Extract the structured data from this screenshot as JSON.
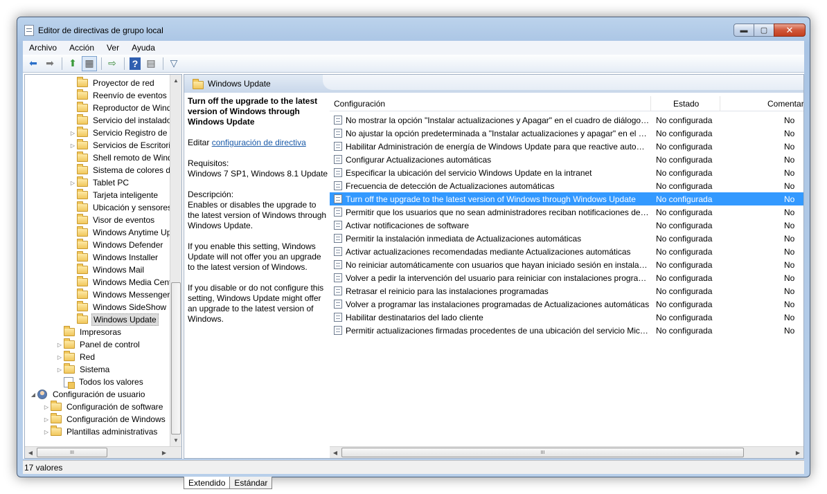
{
  "window": {
    "title": "Editor de directivas de grupo local",
    "buttons": {
      "minimize": "▬",
      "maximize": "▢",
      "close": "✕"
    }
  },
  "menu": [
    "Archivo",
    "Acción",
    "Ver",
    "Ayuda"
  ],
  "toolbar": {
    "icons": [
      "back-arrow-icon",
      "forward-arrow-icon",
      "up-folder-icon",
      "show-hide-tree-icon",
      "export-list-icon",
      "help-icon",
      "properties-icon",
      "filter-icon"
    ],
    "glyphs": [
      "⬅",
      "➡",
      "⬆",
      "▦",
      "⇨",
      "?",
      "▤",
      "▽"
    ]
  },
  "tree": {
    "items": [
      {
        "label": "Proyector de red",
        "indent": 4,
        "expander": ""
      },
      {
        "label": "Reenvío de eventos",
        "indent": 4,
        "expander": ""
      },
      {
        "label": "Reproductor de Windows Media",
        "indent": 4,
        "expander": ""
      },
      {
        "label": "Servicio del instalador de Windows",
        "indent": 4,
        "expander": ""
      },
      {
        "label": "Servicio Registro de errores",
        "indent": 4,
        "expander": "▷"
      },
      {
        "label": "Servicios de Escritorio remoto",
        "indent": 4,
        "expander": "▷"
      },
      {
        "label": "Shell remoto de Windows",
        "indent": 4,
        "expander": ""
      },
      {
        "label": "Sistema de colores de Windows",
        "indent": 4,
        "expander": ""
      },
      {
        "label": "Tablet PC",
        "indent": 4,
        "expander": "▷"
      },
      {
        "label": "Tarjeta inteligente",
        "indent": 4,
        "expander": ""
      },
      {
        "label": "Ubicación y sensores",
        "indent": 4,
        "expander": ""
      },
      {
        "label": "Visor de eventos",
        "indent": 4,
        "expander": ""
      },
      {
        "label": "Windows Anytime Upgrade",
        "indent": 4,
        "expander": ""
      },
      {
        "label": "Windows Defender",
        "indent": 4,
        "expander": ""
      },
      {
        "label": "Windows Installer",
        "indent": 4,
        "expander": ""
      },
      {
        "label": "Windows Mail",
        "indent": 4,
        "expander": ""
      },
      {
        "label": "Windows Media Center",
        "indent": 4,
        "expander": ""
      },
      {
        "label": "Windows Messenger",
        "indent": 4,
        "expander": ""
      },
      {
        "label": "Windows SideShow",
        "indent": 4,
        "expander": ""
      },
      {
        "label": "Windows Update",
        "indent": 4,
        "expander": "",
        "selected": true
      },
      {
        "label": "Impresoras",
        "indent": 3,
        "expander": ""
      },
      {
        "label": "Panel de control",
        "indent": 3,
        "expander": "▷"
      },
      {
        "label": "Red",
        "indent": 3,
        "expander": "▷"
      },
      {
        "label": "Sistema",
        "indent": 3,
        "expander": "▷"
      },
      {
        "label": "Todos los valores",
        "indent": 3,
        "expander": "",
        "icon": "doc"
      },
      {
        "label": "Configuración de usuario",
        "indent": 1,
        "expander": "◢",
        "icon": "user"
      },
      {
        "label": "Configuración de software",
        "indent": 2,
        "expander": "▷"
      },
      {
        "label": "Configuración de Windows",
        "indent": 2,
        "expander": "▷"
      },
      {
        "label": "Plantillas administrativas",
        "indent": 2,
        "expander": "▷"
      }
    ]
  },
  "panel": {
    "header_title": "Windows Update",
    "desc": {
      "title": "Turn off the upgrade to the latest version of Windows through Windows Update",
      "edit_prefix": "Editar ",
      "edit_link": "configuración de directiva",
      "req_label": "Requisitos:",
      "req_value": "Windows 7 SP1, Windows 8.1 Update",
      "desc_label": "Descripción:",
      "desc_value": "Enables or disables the upgrade to the latest version of Windows through Windows Update.",
      "p_enable": "If you enable this setting, Windows Update will not offer you an upgrade to the latest version of Windows.",
      "p_disable": "If you disable or do not configure this setting, Windows Update might offer an upgrade to the latest version of Windows."
    }
  },
  "list": {
    "columns": [
      "Configuración",
      "Estado",
      "Comentario"
    ],
    "rows": [
      {
        "name": "No mostrar la opción \"Instalar actualizaciones y Apagar\" en el cuadro de diálogo Apagar Windows",
        "state": "No configurada",
        "comment": "No"
      },
      {
        "name": "No ajustar la opción predeterminada a \"Instalar actualizaciones y apagar\" en el cuadro de diálogo Apagar Windows",
        "state": "No configurada",
        "comment": "No"
      },
      {
        "name": "Habilitar Administración de energía de Windows Update para que reactive automáticamente el sistema",
        "state": "No configurada",
        "comment": "No"
      },
      {
        "name": "Configurar Actualizaciones automáticas",
        "state": "No configurada",
        "comment": "No"
      },
      {
        "name": "Especificar la ubicación del servicio Windows Update en la intranet",
        "state": "No configurada",
        "comment": "No"
      },
      {
        "name": "Frecuencia de detección de Actualizaciones automáticas",
        "state": "No configurada",
        "comment": "No"
      },
      {
        "name": "Turn off the upgrade to the latest version of Windows through Windows Update",
        "state": "No configurada",
        "comment": "No",
        "selected": true
      },
      {
        "name": "Permitir que los usuarios que no sean administradores reciban notificaciones de actualizaciones",
        "state": "No configurada",
        "comment": "No"
      },
      {
        "name": "Activar notificaciones de software",
        "state": "No configurada",
        "comment": "No"
      },
      {
        "name": "Permitir la instalación inmediata de Actualizaciones automáticas",
        "state": "No configurada",
        "comment": "No"
      },
      {
        "name": "Activar actualizaciones recomendadas mediante Actualizaciones automáticas",
        "state": "No configurada",
        "comment": "No"
      },
      {
        "name": "No reiniciar automáticamente con usuarios que hayan iniciado sesión en instalaciones programadas",
        "state": "No configurada",
        "comment": "No"
      },
      {
        "name": "Volver a pedir la intervención del usuario para reiniciar con instalaciones programadas",
        "state": "No configurada",
        "comment": "No"
      },
      {
        "name": "Retrasar el reinicio para las instalaciones programadas",
        "state": "No configurada",
        "comment": "No"
      },
      {
        "name": "Volver a programar las instalaciones programadas de Actualizaciones automáticas",
        "state": "No configurada",
        "comment": "No"
      },
      {
        "name": "Habilitar destinatarios del lado cliente",
        "state": "No configurada",
        "comment": "No"
      },
      {
        "name": "Permitir actualizaciones firmadas procedentes de una ubicación del servicio Microsoft Update en la intranet",
        "state": "No configurada",
        "comment": "No"
      }
    ]
  },
  "tabs": [
    "Extendido",
    "Estándar"
  ],
  "status": "17 valores",
  "colors": {
    "selection": "#3399ff",
    "link": "#1a5aa8"
  }
}
